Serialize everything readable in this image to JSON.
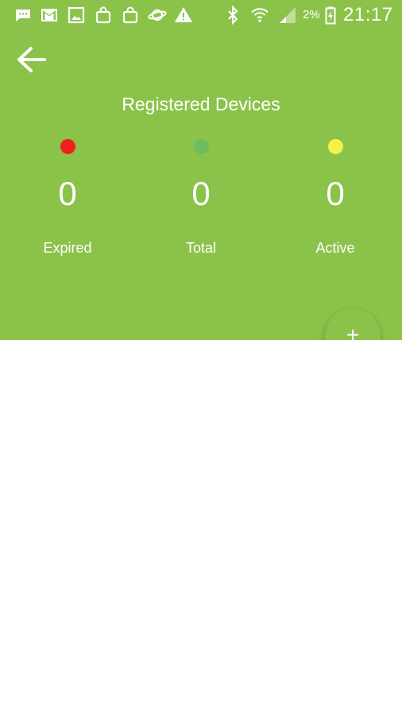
{
  "colors": {
    "header_bg": "#8bc34a",
    "expired_dot": "#f21f1f",
    "total_dot": "#6cbd5c",
    "active_dot": "#f5f14b"
  },
  "status_bar": {
    "battery": "2%",
    "time": "21:17",
    "icons": [
      "message-icon",
      "gmail-icon",
      "image-icon",
      "shopping-bag-icon",
      "shopping-bag-icon",
      "planet-icon",
      "warning-icon",
      "bluetooth-icon",
      "wifi-icon",
      "signal-icon",
      "battery-charging-icon"
    ]
  },
  "header": {
    "back_icon": "arrow-left-icon",
    "title": "Registered Devices"
  },
  "stats": [
    {
      "label": "Expired",
      "value": "0",
      "dot_color": "#f21f1f"
    },
    {
      "label": "Total",
      "value": "0",
      "dot_color": "#6cbd5c"
    },
    {
      "label": "Active",
      "value": "0",
      "dot_color": "#f5f14b"
    }
  ],
  "fab": {
    "label": "+",
    "icon": "add-icon"
  }
}
